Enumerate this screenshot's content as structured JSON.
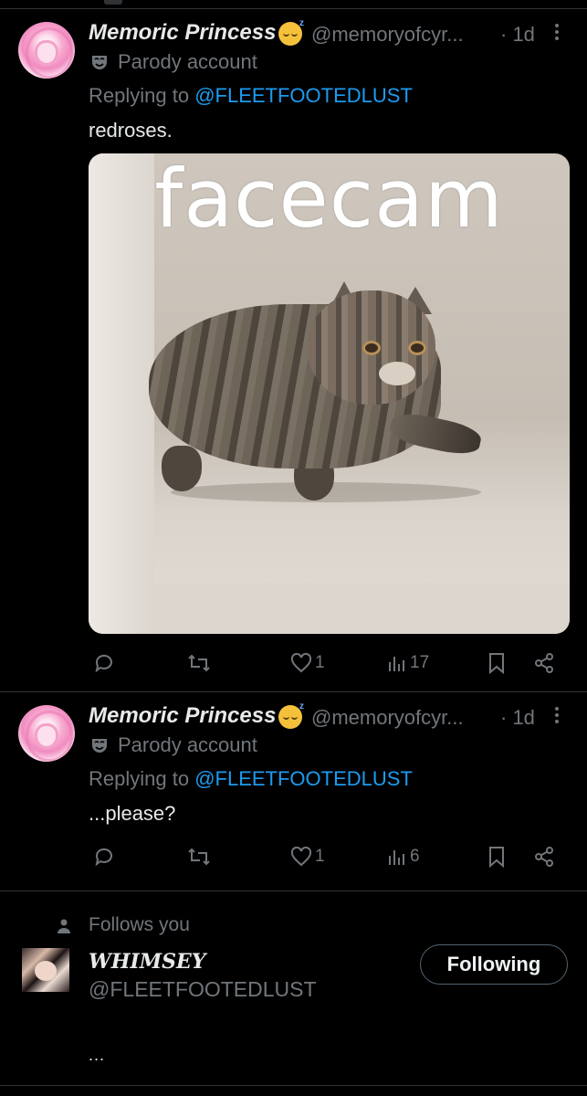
{
  "posts": [
    {
      "display_name": "Memoric Princess",
      "emoji_icon": "sleeping-face-emoji",
      "handle": "@memoryofcyr...",
      "time": "· 1d",
      "parody_label": "Parody account",
      "replying_prefix": "Replying to ",
      "replying_to": "@FLEETFOOTEDLUST",
      "text": "redroses.",
      "media": {
        "meme_caption": "facecam",
        "description_icon": "cat-walking-image"
      },
      "actions": {
        "reply": "",
        "repost": "",
        "likes": "1",
        "views": "17"
      }
    },
    {
      "display_name": "Memoric Princess",
      "emoji_icon": "sleeping-face-emoji",
      "handle": "@memoryofcyr...",
      "time": "· 1d",
      "parody_label": "Parody account",
      "replying_prefix": "Replying to ",
      "replying_to": "@FLEETFOOTEDLUST",
      "text": "...please?",
      "actions": {
        "reply": "",
        "repost": "",
        "likes": "1",
        "views": "6"
      }
    }
  ],
  "follower": {
    "follows_label": "Follows you",
    "name": "WHIMSEY",
    "handle": "@FLEETFOOTEDLUST",
    "button_label": "Following",
    "bio_more": "..."
  },
  "colors": {
    "background": "#000000",
    "text": "#e7e9ea",
    "muted": "#71767b",
    "link": "#1d9bf0",
    "divider": "#2f3336"
  }
}
